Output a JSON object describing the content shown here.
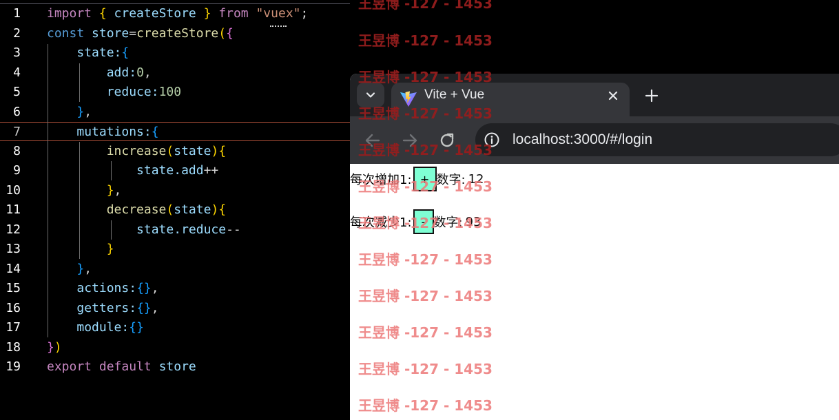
{
  "editor": {
    "lines": [
      {
        "n": "1",
        "active": false,
        "tokens": [
          [
            "kw",
            "import "
          ],
          [
            "br",
            "{ "
          ],
          [
            "var",
            "createStore "
          ],
          [
            "br",
            "} "
          ],
          [
            "kw",
            "from "
          ],
          [
            "str",
            "\"vuex\""
          ],
          [
            "wh",
            ";"
          ]
        ]
      },
      {
        "n": "2",
        "active": false,
        "tokens": [
          [
            "kb",
            "const "
          ],
          [
            "var",
            "store"
          ],
          [
            "wh",
            "="
          ],
          [
            "fn",
            "createStore"
          ],
          [
            "br",
            "("
          ],
          [
            "br2",
            "{"
          ]
        ]
      },
      {
        "n": "3",
        "active": false,
        "tokens": [
          [
            "wh",
            "    "
          ],
          [
            "var",
            "state:"
          ],
          [
            "br3",
            "{"
          ]
        ]
      },
      {
        "n": "4",
        "active": false,
        "tokens": [
          [
            "wh",
            "        "
          ],
          [
            "var",
            "add:"
          ],
          [
            "num",
            "0"
          ],
          [
            "wh",
            ","
          ]
        ]
      },
      {
        "n": "5",
        "active": false,
        "tokens": [
          [
            "wh",
            "        "
          ],
          [
            "var",
            "reduce:"
          ],
          [
            "num",
            "100"
          ]
        ]
      },
      {
        "n": "6",
        "active": false,
        "tokens": [
          [
            "wh",
            "    "
          ],
          [
            "br3",
            "}"
          ],
          [
            "wh",
            ","
          ]
        ]
      },
      {
        "n": "7",
        "active": true,
        "tokens": [
          [
            "wh",
            "    "
          ],
          [
            "var",
            "mutations:"
          ],
          [
            "br3",
            "{"
          ]
        ]
      },
      {
        "n": "8",
        "active": false,
        "tokens": [
          [
            "wh",
            "        "
          ],
          [
            "fn",
            "increase"
          ],
          [
            "br",
            "("
          ],
          [
            "var",
            "state"
          ],
          [
            "br",
            ")"
          ],
          [
            "br",
            "{"
          ]
        ]
      },
      {
        "n": "9",
        "active": false,
        "tokens": [
          [
            "wh",
            "            "
          ],
          [
            "var",
            "state.add"
          ],
          [
            "wh",
            "++"
          ]
        ]
      },
      {
        "n": "10",
        "active": false,
        "tokens": [
          [
            "wh",
            "        "
          ],
          [
            "br",
            "}"
          ],
          [
            "wh",
            ","
          ]
        ]
      },
      {
        "n": "11",
        "active": false,
        "tokens": [
          [
            "wh",
            "        "
          ],
          [
            "fn",
            "decrease"
          ],
          [
            "br",
            "("
          ],
          [
            "var",
            "state"
          ],
          [
            "br",
            ")"
          ],
          [
            "br",
            "{"
          ]
        ]
      },
      {
        "n": "12",
        "active": false,
        "tokens": [
          [
            "wh",
            "            "
          ],
          [
            "var",
            "state.reduce"
          ],
          [
            "wh",
            "--"
          ]
        ]
      },
      {
        "n": "13",
        "active": false,
        "tokens": [
          [
            "wh",
            "        "
          ],
          [
            "br",
            "}"
          ]
        ]
      },
      {
        "n": "14",
        "active": false,
        "tokens": [
          [
            "wh",
            "    "
          ],
          [
            "br3",
            "}"
          ],
          [
            "wh",
            ","
          ]
        ]
      },
      {
        "n": "15",
        "active": false,
        "tokens": [
          [
            "wh",
            "    "
          ],
          [
            "var",
            "actions:"
          ],
          [
            "br3",
            "{}"
          ],
          [
            "wh",
            ","
          ]
        ]
      },
      {
        "n": "16",
        "active": false,
        "tokens": [
          [
            "wh",
            "    "
          ],
          [
            "var",
            "getters:"
          ],
          [
            "br3",
            "{}"
          ],
          [
            "wh",
            ","
          ]
        ]
      },
      {
        "n": "17",
        "active": false,
        "tokens": [
          [
            "wh",
            "    "
          ],
          [
            "var",
            "module:"
          ],
          [
            "br3",
            "{}"
          ]
        ]
      },
      {
        "n": "18",
        "active": false,
        "tokens": [
          [
            "br2",
            "}"
          ],
          [
            "br",
            ")"
          ]
        ]
      },
      {
        "n": "19",
        "active": false,
        "tokens": [
          [
            "kw",
            "export "
          ],
          [
            "kw",
            "default "
          ],
          [
            "var",
            "store"
          ]
        ]
      }
    ]
  },
  "browser": {
    "tab_title": "Vite + Vue",
    "url": "localhost:3000/#/login",
    "new_tab_label": "+",
    "icons": {
      "dropdown": "chevron-down-icon",
      "favicon": "vite-logo-icon",
      "close": "close-icon",
      "back": "arrow-left-icon",
      "forward": "arrow-right-icon",
      "reload": "reload-icon",
      "info": "info-icon"
    }
  },
  "app": {
    "increase_label": "每次增加1:",
    "increase_button": "+",
    "increase_number_label": "数字:",
    "increase_value": "12",
    "decrease_label": "每次减少1:",
    "decrease_button": "-",
    "decrease_number_label": "数字:",
    "decrease_value": "93"
  },
  "watermark": {
    "text": "王昱博 -127 - 1453"
  },
  "colors": {
    "button_bg": "#7fffd4",
    "watermark_dark": "#961e1e",
    "watermark_light": "#ec7878",
    "current_line_border": "#b0503a"
  }
}
